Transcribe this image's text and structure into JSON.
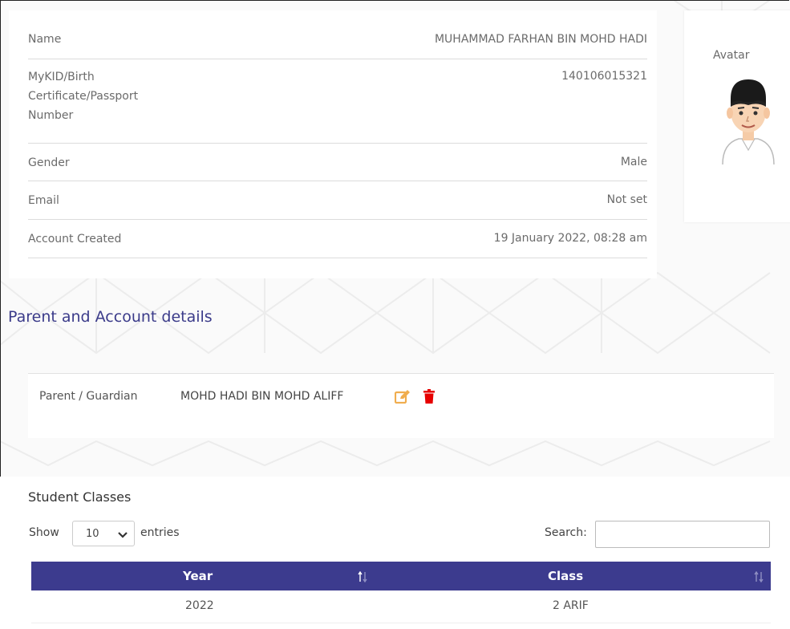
{
  "student": {
    "rows": [
      {
        "label": "Name",
        "value": "MUHAMMAD FARHAN BIN MOHD HADI"
      },
      {
        "label": "MyKID/Birth Certificate/Passport Number",
        "label_lines": [
          "MyKID/Birth",
          "Certificate/Passport",
          "Number"
        ],
        "value": "140106015321"
      },
      {
        "label": "Gender",
        "value": "Male"
      },
      {
        "label": "Email",
        "value": "Not set"
      },
      {
        "label": "Account Created",
        "value": "19 January 2022, 08:28 am"
      }
    ]
  },
  "avatar": {
    "title": "Avatar"
  },
  "parent_section": {
    "title": "Parent and Account details",
    "label": "Parent / Guardian",
    "name": "MOHD HADI BIN MOHD ALIFF",
    "edit_color": "#f0ad4e",
    "delete_color": "#e60000"
  },
  "classes": {
    "title": "Student Classes",
    "show_label": "Show",
    "entries_value": "10",
    "entries_label": "entries",
    "search_label": "Search:",
    "search_value": "",
    "columns": [
      "Year",
      "Class"
    ],
    "rows": [
      {
        "year": "2022",
        "class": "2 ARIF"
      }
    ],
    "header_color": "#3c3b8e"
  }
}
